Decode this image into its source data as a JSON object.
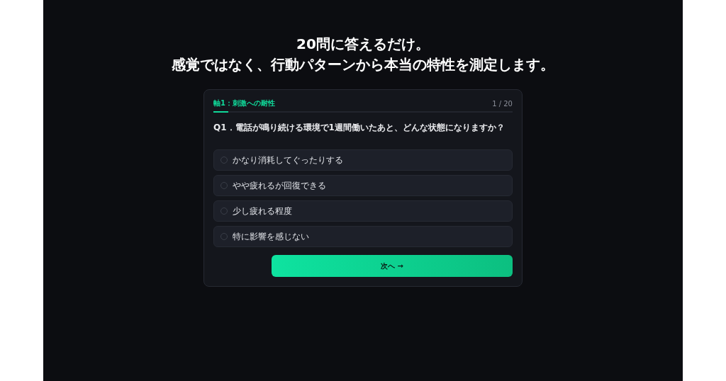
{
  "headline": [
    "20問に答えるだけ。",
    "感覚ではなく、行動パターンから本当の特性を測定します。"
  ],
  "quiz": {
    "axis": "軸1：刺激への耐性",
    "counter": "1 / 20",
    "progress": {
      "level": 0.05
    },
    "question": "Q1．電話が鳴り続ける環境で1週間働いたあと、どんな状態になりますか？",
    "options": [
      {
        "label": "かなり消耗してぐったりする",
        "selected": false
      },
      {
        "label": "やや疲れるが回復できる",
        "selected": false
      },
      {
        "label": "少し疲れる程度",
        "selected": false
      },
      {
        "label": "特に影響を感じない",
        "selected": false
      }
    ],
    "next_button": "次へ →"
  }
}
